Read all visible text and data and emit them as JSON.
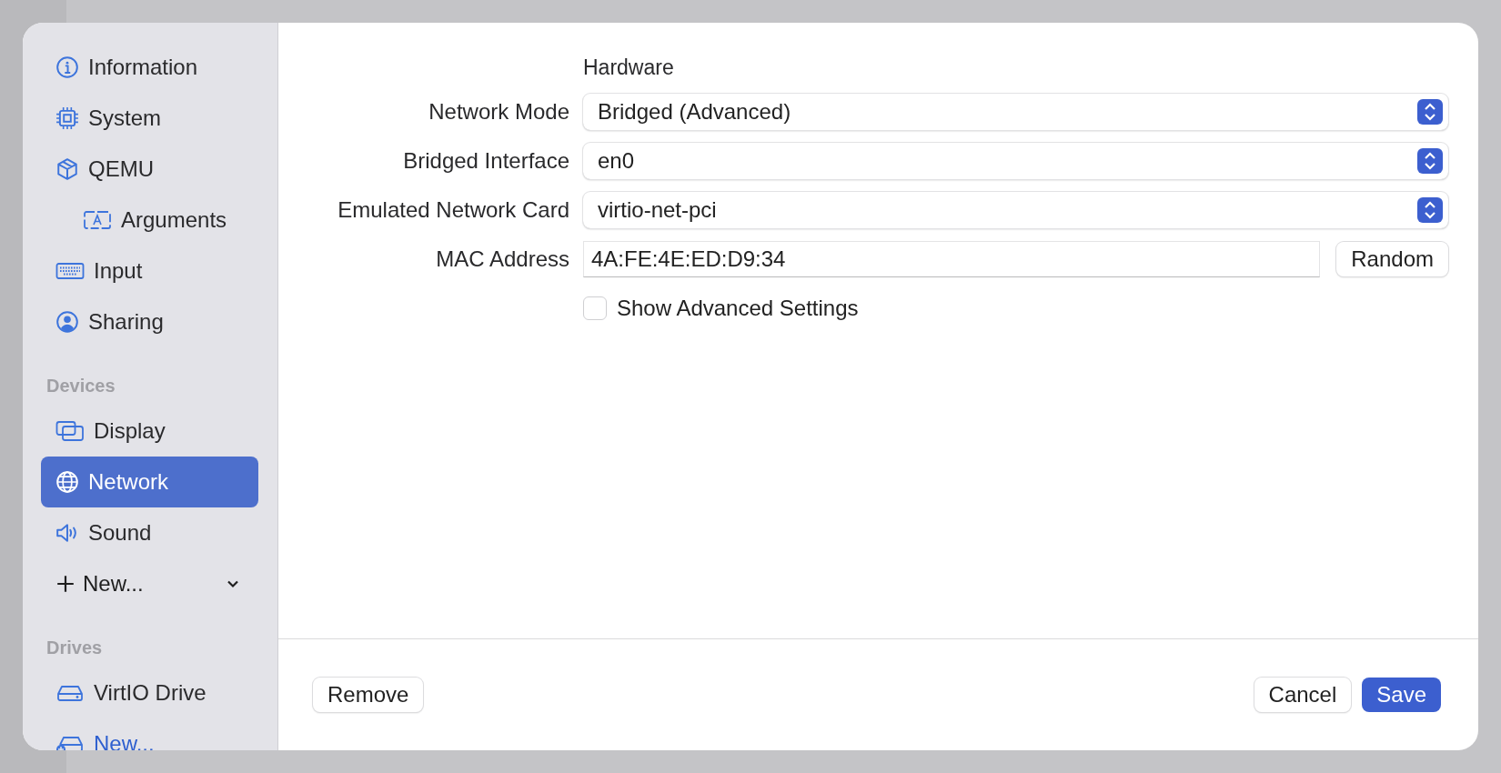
{
  "sidebar": {
    "sections": [
      {
        "items": [
          {
            "label": "Information",
            "selected": false
          },
          {
            "label": "System",
            "selected": false
          },
          {
            "label": "QEMU",
            "selected": false,
            "children": [
              {
                "label": "Arguments",
                "selected": false
              }
            ]
          },
          {
            "label": "Input",
            "selected": false
          },
          {
            "label": "Sharing",
            "selected": false
          }
        ]
      },
      {
        "header": "Devices",
        "items": [
          {
            "label": "Display",
            "selected": false
          },
          {
            "label": "Network",
            "selected": true
          },
          {
            "label": "Sound",
            "selected": false
          }
        ],
        "add_menu": "New..."
      },
      {
        "header": "Drives",
        "items": [
          {
            "label": "VirtIO Drive",
            "selected": false
          }
        ],
        "add_link": "New..."
      }
    ]
  },
  "form": {
    "heading": "Hardware",
    "rows": [
      {
        "kind": "select",
        "label": "Network Mode",
        "value": "Bridged (Advanced)"
      },
      {
        "kind": "select",
        "label": "Bridged Interface",
        "value": "en0"
      },
      {
        "kind": "select",
        "label": "Emulated Network Card",
        "value": "virtio-net-pci"
      },
      {
        "kind": "text",
        "label": "MAC Address",
        "value": "4A:FE:4E:ED:D9:34",
        "button": "Random"
      }
    ],
    "checkbox": {
      "label": "Show Advanced Settings",
      "checked": false
    }
  },
  "footer": {
    "left_button": "Remove",
    "buttons": [
      {
        "label": "Cancel",
        "primary": false
      },
      {
        "label": "Save",
        "primary": true
      }
    ]
  }
}
